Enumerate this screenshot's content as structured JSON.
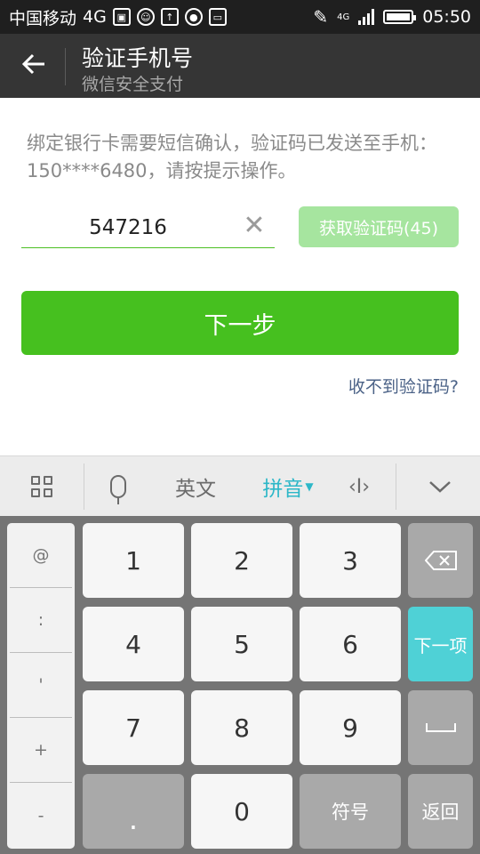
{
  "status_bar": {
    "carrier": "中国移动",
    "network": "4G",
    "signal_network": "4G",
    "time": "05:50"
  },
  "header": {
    "title": "验证手机号",
    "subtitle": "微信安全支付"
  },
  "form": {
    "description": "绑定银行卡需要短信确认，验证码已发送至手机：150****6480，请按提示操作。",
    "code_value": "547216",
    "get_code_label": "获取验证码(45)",
    "next_label": "下一步",
    "no_code_link": "收不到验证码?"
  },
  "keyboard": {
    "toolbar": {
      "english": "英文",
      "pinyin": "拼音"
    },
    "side_keys": [
      "@",
      ":",
      "'",
      "+",
      "-"
    ],
    "digits": [
      "1",
      "2",
      "3",
      "4",
      "5",
      "6",
      "7",
      "8",
      "9",
      "0"
    ],
    "dot": ".",
    "next_item": "下一项",
    "symbols": "符号",
    "back": "返回"
  },
  "colors": {
    "primary_green": "#46c01f",
    "disabled_green": "#a6e59f",
    "accent_teal": "#4fd1d6",
    "link_blue": "#4b6287"
  }
}
